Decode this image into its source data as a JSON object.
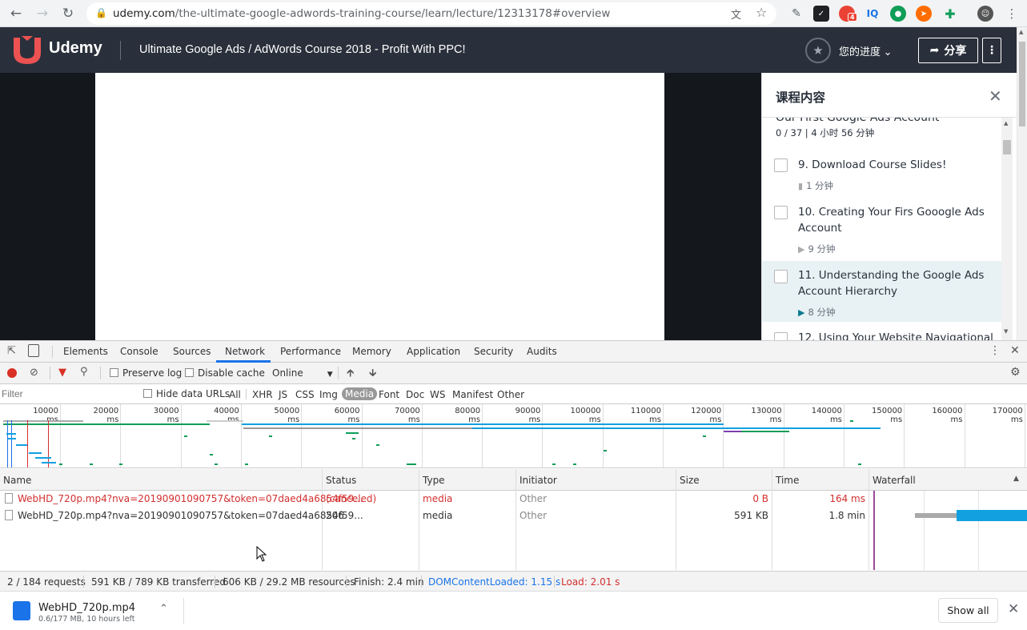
{
  "browser": {
    "url_host": "udemy.com",
    "url_path": "/the-ultimate-google-adwords-training-course/learn/lecture/12313178#overview",
    "extension_badge": "4",
    "extension_iq": "IQ"
  },
  "header": {
    "logo_text": "Udemy",
    "course_title": "Ultimate Google Ads / AdWords Course 2018 - Profit With PPC!",
    "progress_label": "您的进度",
    "share_label": "分享"
  },
  "sidebar": {
    "title": "课程内容",
    "section_title_cut": "Our First Google Ads Account",
    "section_meta": "0 / 37 | 4 小时 56 分钟",
    "lectures": [
      {
        "title": "9. Download Course Slides!",
        "duration": "1 分钟",
        "kind": "file-icon"
      },
      {
        "title": "10. Creating Your Firs Gooogle Ads Account",
        "duration": "9 分钟",
        "kind": "play-icon"
      },
      {
        "title": "11. Understanding the Google Ads Account Hierarchy",
        "duration": "8 分钟",
        "kind": "play-icon"
      },
      {
        "title": "12. Using Your Website Navigational",
        "duration": "",
        "kind": ""
      }
    ]
  },
  "devtools": {
    "tabs": [
      "Elements",
      "Console",
      "Sources",
      "Network",
      "Performance",
      "Memory",
      "Application",
      "Security",
      "Audits"
    ],
    "active_tab": "Network",
    "toolbar": {
      "preserve_log": "Preserve log",
      "disable_cache": "Disable cache",
      "throttle": "Online"
    },
    "filter": {
      "placeholder": "Filter",
      "hide_data_urls": "Hide data URLs",
      "types": [
        "All",
        "XHR",
        "JS",
        "CSS",
        "Img",
        "Media",
        "Font",
        "Doc",
        "WS",
        "Manifest",
        "Other"
      ],
      "active_type": "Media"
    },
    "timeline_ticks": [
      "10000 ms",
      "20000 ms",
      "30000 ms",
      "40000 ms",
      "50000 ms",
      "60000 ms",
      "70000 ms",
      "80000 ms",
      "90000 ms",
      "100000 ms",
      "110000 ms",
      "120000 ms",
      "130000 ms",
      "140000 ms",
      "150000 ms",
      "160000 ms",
      "170000 ms"
    ],
    "columns": [
      "Name",
      "Status",
      "Type",
      "Initiator",
      "Size",
      "Time",
      "Waterfall"
    ],
    "requests": [
      {
        "name": "WebHD_720p.mp4?nva=20190901090757&token=07daed4a6854f59...",
        "status": "(canceled)",
        "type": "media",
        "initiator": "Other",
        "size": "0 B",
        "time": "164 ms",
        "error": true
      },
      {
        "name": "WebHD_720p.mp4?nva=20190901090757&token=07daed4a6854f59...",
        "status": "206",
        "type": "media",
        "initiator": "Other",
        "size": "591 KB",
        "time": "1.8 min",
        "error": false
      }
    ],
    "status_bar": {
      "requests": "2 / 184 requests",
      "transferred": "591 KB / 789 KB transferred",
      "resources": "606 KB / 29.2 MB resources",
      "finish": "Finish: 2.4 min",
      "dom_content_loaded": "DOMContentLoaded: 1.15 s",
      "load": "Load: 2.01 s"
    }
  },
  "download": {
    "file_name": "WebHD_720p.mp4",
    "meta": "0.6/177 MB, 10 hours left",
    "show_all": "Show all"
  },
  "colors": {
    "udemy_red": "#ec5252",
    "header_bg": "#29303b",
    "devtools_accent": "#1a73e8",
    "error_red": "#d32f2f"
  }
}
